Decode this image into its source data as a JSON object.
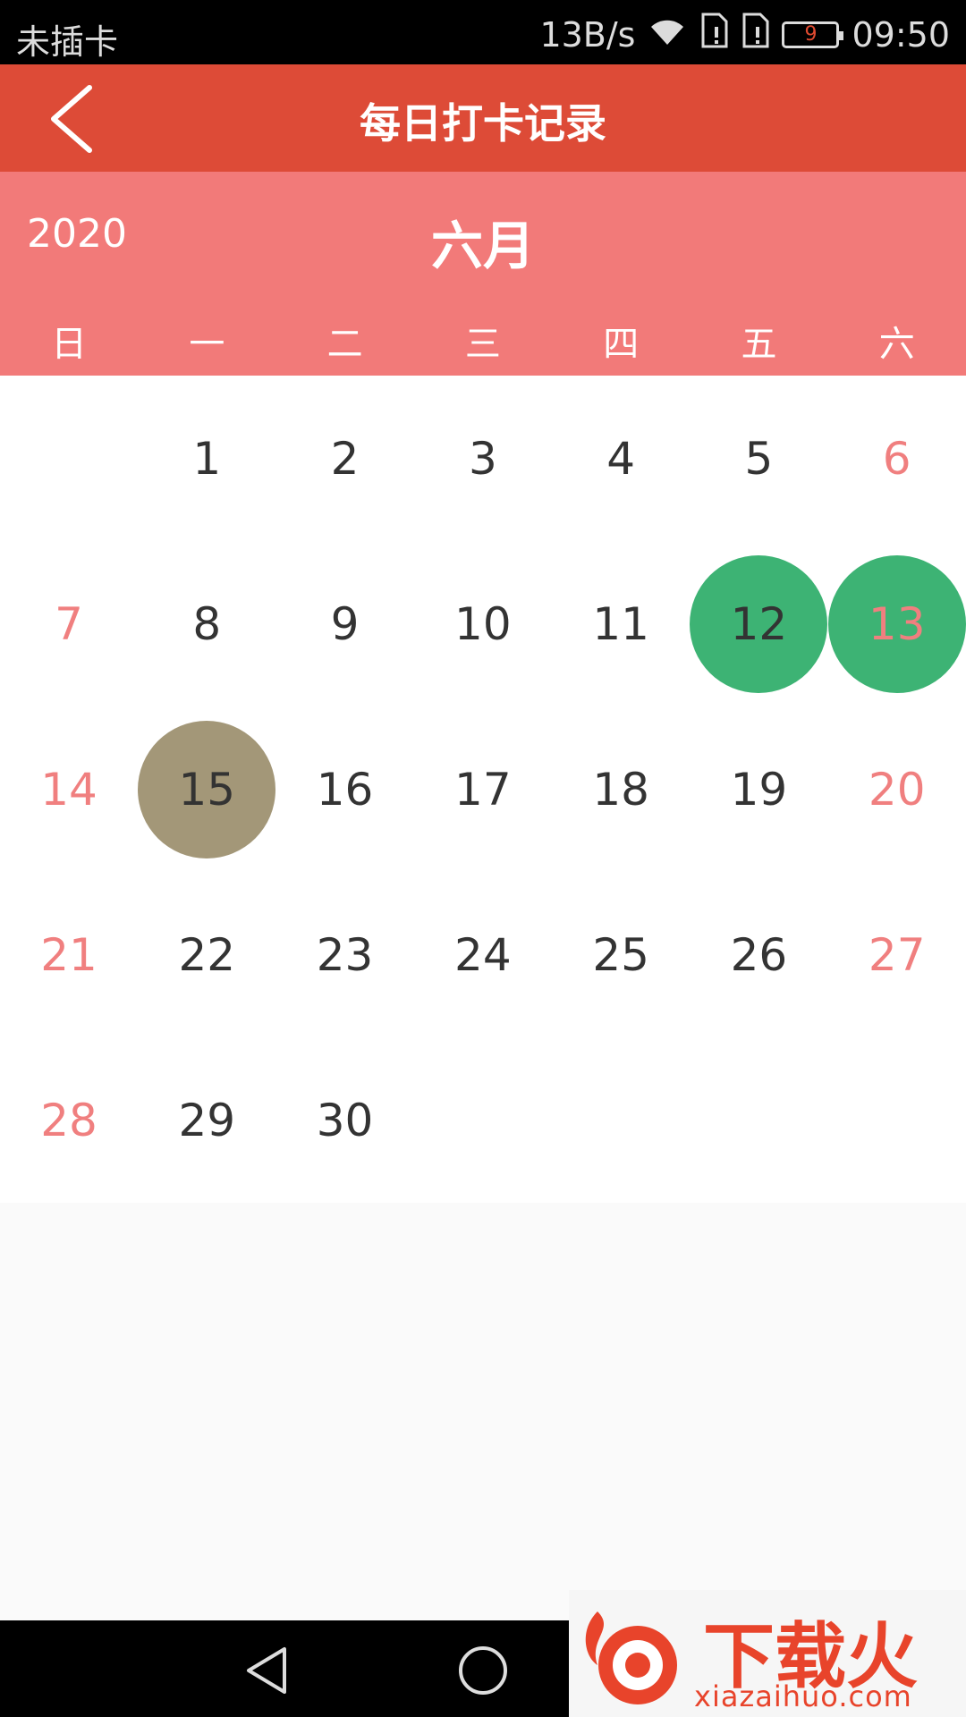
{
  "status_bar": {
    "carrier": "未插卡",
    "net_speed": "13B/s",
    "battery_level": "9",
    "time": "09:50"
  },
  "title_bar": {
    "title": "每日打卡记录",
    "back_icon": "back-chevron-icon"
  },
  "calendar": {
    "year": "2020",
    "month": "六月",
    "weekdays": [
      "日",
      "一",
      "二",
      "三",
      "四",
      "五",
      "六"
    ],
    "days": [
      {
        "label": "1",
        "col": 1,
        "row": 0,
        "weekend": false,
        "state": "normal"
      },
      {
        "label": "2",
        "col": 2,
        "row": 0,
        "weekend": false,
        "state": "normal"
      },
      {
        "label": "3",
        "col": 3,
        "row": 0,
        "weekend": false,
        "state": "normal"
      },
      {
        "label": "4",
        "col": 4,
        "row": 0,
        "weekend": false,
        "state": "normal"
      },
      {
        "label": "5",
        "col": 5,
        "row": 0,
        "weekend": false,
        "state": "normal"
      },
      {
        "label": "6",
        "col": 6,
        "row": 0,
        "weekend": true,
        "state": "normal"
      },
      {
        "label": "7",
        "col": 0,
        "row": 1,
        "weekend": true,
        "state": "normal"
      },
      {
        "label": "8",
        "col": 1,
        "row": 1,
        "weekend": false,
        "state": "normal"
      },
      {
        "label": "9",
        "col": 2,
        "row": 1,
        "weekend": false,
        "state": "normal"
      },
      {
        "label": "10",
        "col": 3,
        "row": 1,
        "weekend": false,
        "state": "normal"
      },
      {
        "label": "11",
        "col": 4,
        "row": 1,
        "weekend": false,
        "state": "normal"
      },
      {
        "label": "12",
        "col": 5,
        "row": 1,
        "weekend": false,
        "state": "checked"
      },
      {
        "label": "13",
        "col": 6,
        "row": 1,
        "weekend": true,
        "state": "checked"
      },
      {
        "label": "14",
        "col": 0,
        "row": 2,
        "weekend": true,
        "state": "normal"
      },
      {
        "label": "15",
        "col": 1,
        "row": 2,
        "weekend": false,
        "state": "today"
      },
      {
        "label": "16",
        "col": 2,
        "row": 2,
        "weekend": false,
        "state": "normal"
      },
      {
        "label": "17",
        "col": 3,
        "row": 2,
        "weekend": false,
        "state": "normal"
      },
      {
        "label": "18",
        "col": 4,
        "row": 2,
        "weekend": false,
        "state": "normal"
      },
      {
        "label": "19",
        "col": 5,
        "row": 2,
        "weekend": false,
        "state": "normal"
      },
      {
        "label": "20",
        "col": 6,
        "row": 2,
        "weekend": true,
        "state": "normal"
      },
      {
        "label": "21",
        "col": 0,
        "row": 3,
        "weekend": true,
        "state": "normal"
      },
      {
        "label": "22",
        "col": 1,
        "row": 3,
        "weekend": false,
        "state": "normal"
      },
      {
        "label": "23",
        "col": 2,
        "row": 3,
        "weekend": false,
        "state": "normal"
      },
      {
        "label": "24",
        "col": 3,
        "row": 3,
        "weekend": false,
        "state": "normal"
      },
      {
        "label": "25",
        "col": 4,
        "row": 3,
        "weekend": false,
        "state": "normal"
      },
      {
        "label": "26",
        "col": 5,
        "row": 3,
        "weekend": false,
        "state": "normal"
      },
      {
        "label": "27",
        "col": 6,
        "row": 3,
        "weekend": true,
        "state": "normal"
      },
      {
        "label": "28",
        "col": 0,
        "row": 4,
        "weekend": true,
        "state": "normal"
      },
      {
        "label": "29",
        "col": 1,
        "row": 4,
        "weekend": false,
        "state": "normal"
      },
      {
        "label": "30",
        "col": 2,
        "row": 4,
        "weekend": false,
        "state": "normal"
      }
    ]
  },
  "colors": {
    "title_bar": "#dd4b37",
    "calendar_header": "#f27a79",
    "checked": "#3db374",
    "today": "#a39778",
    "weekend_text": "#f07f7f"
  },
  "watermark": {
    "text": "下载火",
    "url": "xiazaihuo.com"
  }
}
